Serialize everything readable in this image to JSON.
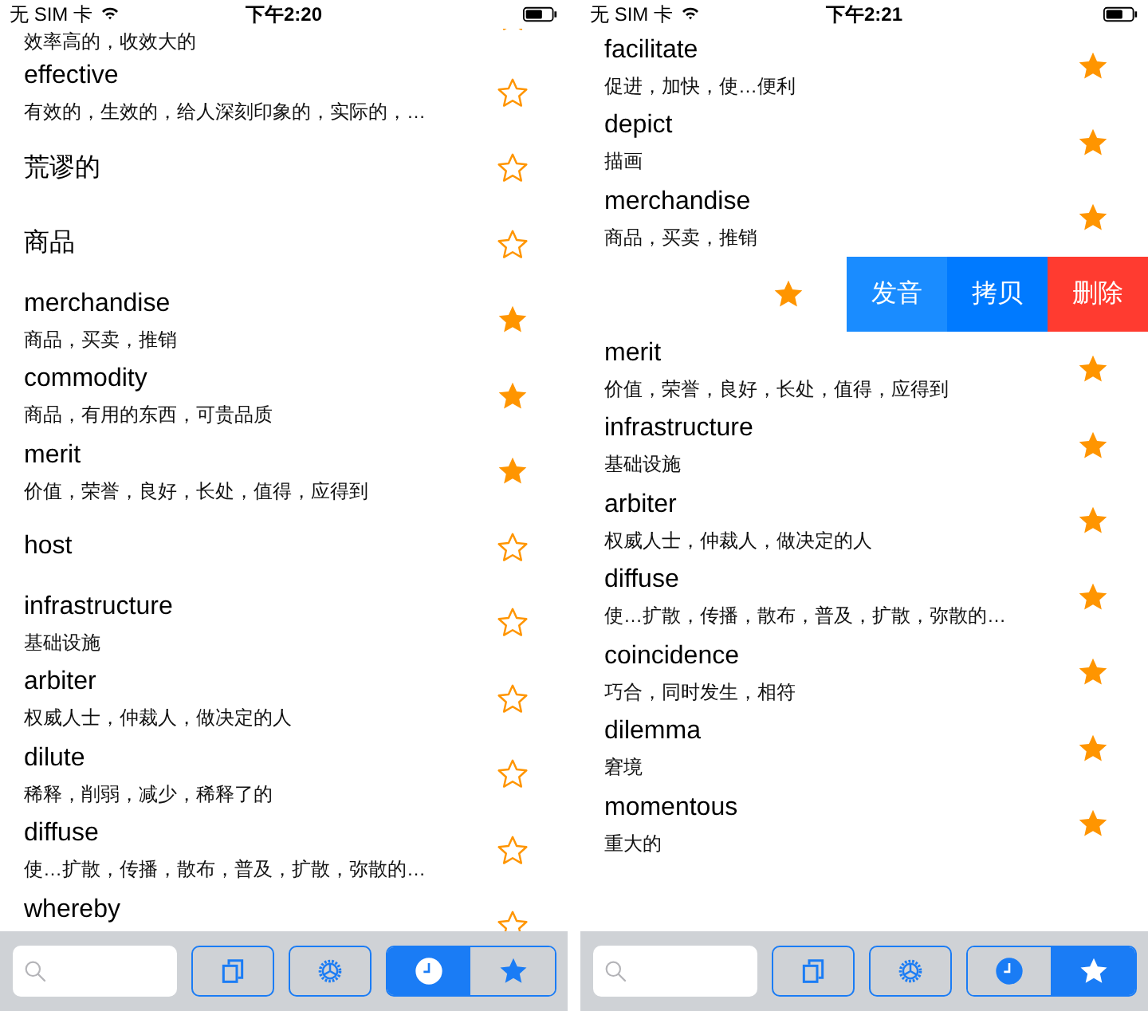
{
  "phones": [
    {
      "status_bar": {
        "carrier": "无 SIM 卡",
        "time": "下午2:20"
      },
      "words": [
        {
          "kind": "partial",
          "meaning": "效率高的，收效大的",
          "starred": false
        },
        {
          "kind": "entry",
          "word": "effective",
          "meaning": "有效的，生效的，给人深刻印象的，实际的，…",
          "starred": false
        },
        {
          "kind": "entry",
          "word": "荒谬的",
          "starred": false
        },
        {
          "kind": "entry",
          "word": "商品",
          "starred": false
        },
        {
          "kind": "entry",
          "word": "merchandise",
          "meaning": "商品，买卖，推销",
          "starred": true
        },
        {
          "kind": "entry",
          "word": "commodity",
          "meaning": "商品，有用的东西，可贵品质",
          "starred": true
        },
        {
          "kind": "entry",
          "word": "merit",
          "meaning": "价值，荣誉，良好，长处，值得，应得到",
          "starred": true
        },
        {
          "kind": "entry",
          "word": "host",
          "starred": false
        },
        {
          "kind": "entry",
          "word": "infrastructure",
          "meaning": "基础设施",
          "starred": false
        },
        {
          "kind": "entry",
          "word": "arbiter",
          "meaning": "权威人士，仲裁人，做决定的人",
          "starred": false
        },
        {
          "kind": "entry",
          "word": "dilute",
          "meaning": "稀释，削弱，减少，稀释了的",
          "starred": false
        },
        {
          "kind": "entry",
          "word": "diffuse",
          "meaning": "使…扩散，传播，散布，普及，扩散，弥散的…",
          "starred": false
        },
        {
          "kind": "cutoff",
          "word": "whereby",
          "starred": false
        }
      ],
      "toolbar": {
        "tabs": [
          {
            "kind": "history",
            "selected": true
          },
          {
            "kind": "favorites",
            "selected": false
          }
        ]
      }
    },
    {
      "status_bar": {
        "carrier": "无 SIM 卡",
        "time": "下午2:21"
      },
      "words": [
        {
          "kind": "entry",
          "word": "facilitate",
          "meaning": "促进，加快，使…便利",
          "starred": true
        },
        {
          "kind": "entry",
          "word": "depict",
          "meaning": "描画",
          "starred": true
        },
        {
          "kind": "entry",
          "word": "merchandise",
          "meaning": "商品，买卖，推销",
          "starred": true
        },
        {
          "kind": "swiped",
          "starred": true,
          "actions": [
            {
              "label": "发音",
              "color": "#1a8cff"
            },
            {
              "label": "拷贝",
              "color": "#007aff"
            },
            {
              "label": "删除",
              "color": "#ff3b30"
            }
          ]
        },
        {
          "kind": "entry",
          "word": "merit",
          "meaning": "价值，荣誉，良好，长处，值得，应得到",
          "starred": true
        },
        {
          "kind": "entry",
          "word": "infrastructure",
          "meaning": "基础设施",
          "starred": true
        },
        {
          "kind": "entry",
          "word": "arbiter",
          "meaning": "权威人士，仲裁人，做决定的人",
          "starred": true
        },
        {
          "kind": "entry",
          "word": "diffuse",
          "meaning": "使…扩散，传播，散布，普及，扩散，弥散的…",
          "starred": true
        },
        {
          "kind": "entry",
          "word": "coincidence",
          "meaning": "巧合，同时发生，相符",
          "starred": true
        },
        {
          "kind": "entry",
          "word": "dilemma",
          "meaning": "窘境",
          "starred": true
        },
        {
          "kind": "entry",
          "word": "momentous",
          "meaning": "重大的",
          "starred": true
        }
      ],
      "toolbar": {
        "tabs": [
          {
            "kind": "history",
            "selected": false
          },
          {
            "kind": "favorites",
            "selected": true
          }
        ]
      }
    }
  ]
}
